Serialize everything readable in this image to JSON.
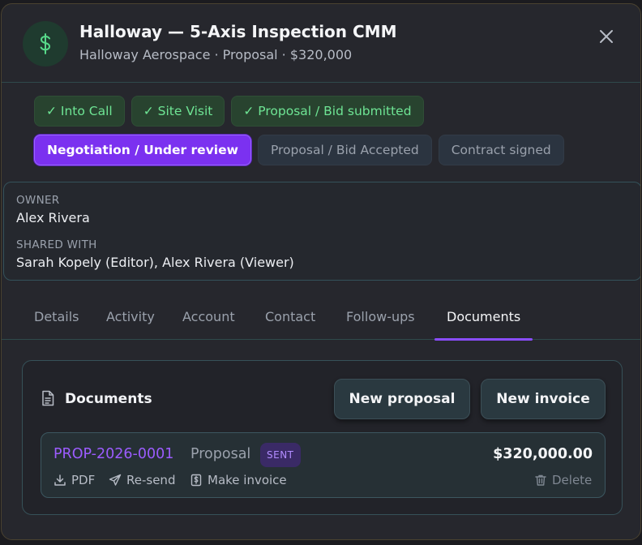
{
  "header": {
    "title": "Halloway — 5-Axis Inspection CMM",
    "subtitle": "Halloway Aerospace · Proposal · $320,000",
    "avatar_icon": "dollar-icon",
    "close_icon": "close-icon"
  },
  "stages": {
    "row1": [
      {
        "label": "✓ Into Call",
        "state": "done"
      },
      {
        "label": "✓ Site Visit",
        "state": "done"
      },
      {
        "label": "✓ Proposal / Bid submitted",
        "state": "done"
      }
    ],
    "row2": [
      {
        "label": "Negotiation / Under review",
        "state": "active"
      },
      {
        "label": "Proposal / Bid Accepted",
        "state": "pending"
      },
      {
        "label": "Contract signed",
        "state": "pending"
      }
    ]
  },
  "owner": {
    "owner_label": "OWNER",
    "owner_value": "Alex Rivera",
    "shared_label": "SHARED WITH",
    "shared_value": "Sarah Kopely (Editor), Alex Rivera (Viewer)"
  },
  "tabs": [
    "Details",
    "Activity",
    "Account",
    "Contact",
    "Follow-ups",
    "Documents"
  ],
  "active_tab": "Documents",
  "documents": {
    "title": "Documents",
    "new_proposal": "New proposal",
    "new_invoice": "New invoice",
    "items": [
      {
        "id": "PROP-2026-0001",
        "type": "Proposal",
        "status": "SENT",
        "amount": "$320,000.00",
        "actions": {
          "pdf": "PDF",
          "resend": "Re-send",
          "make_invoice": "Make invoice",
          "delete": "Delete"
        }
      }
    ]
  },
  "colors": {
    "accent": "#7b31f0",
    "success": "#6ee494",
    "link": "#9c5cff"
  }
}
